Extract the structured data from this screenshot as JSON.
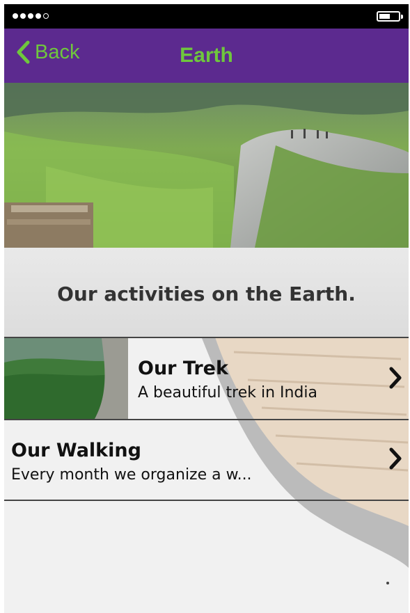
{
  "nav": {
    "back_label": "Back",
    "title": "Earth"
  },
  "heading": "Our activities on the Earth.",
  "items": [
    {
      "title": "Our Trek",
      "subtitle": "A beautiful trek in India"
    },
    {
      "title": "Our Walking",
      "subtitle": "Every month we organize a w..."
    }
  ],
  "icons": [
    "signal-dots-icon",
    "battery-icon",
    "chevron-left-icon",
    "chevron-right-icon"
  ],
  "colors": {
    "nav_bg": "#5c2a8f",
    "accent": "#6fc73d",
    "status_bar": "#000000"
  }
}
